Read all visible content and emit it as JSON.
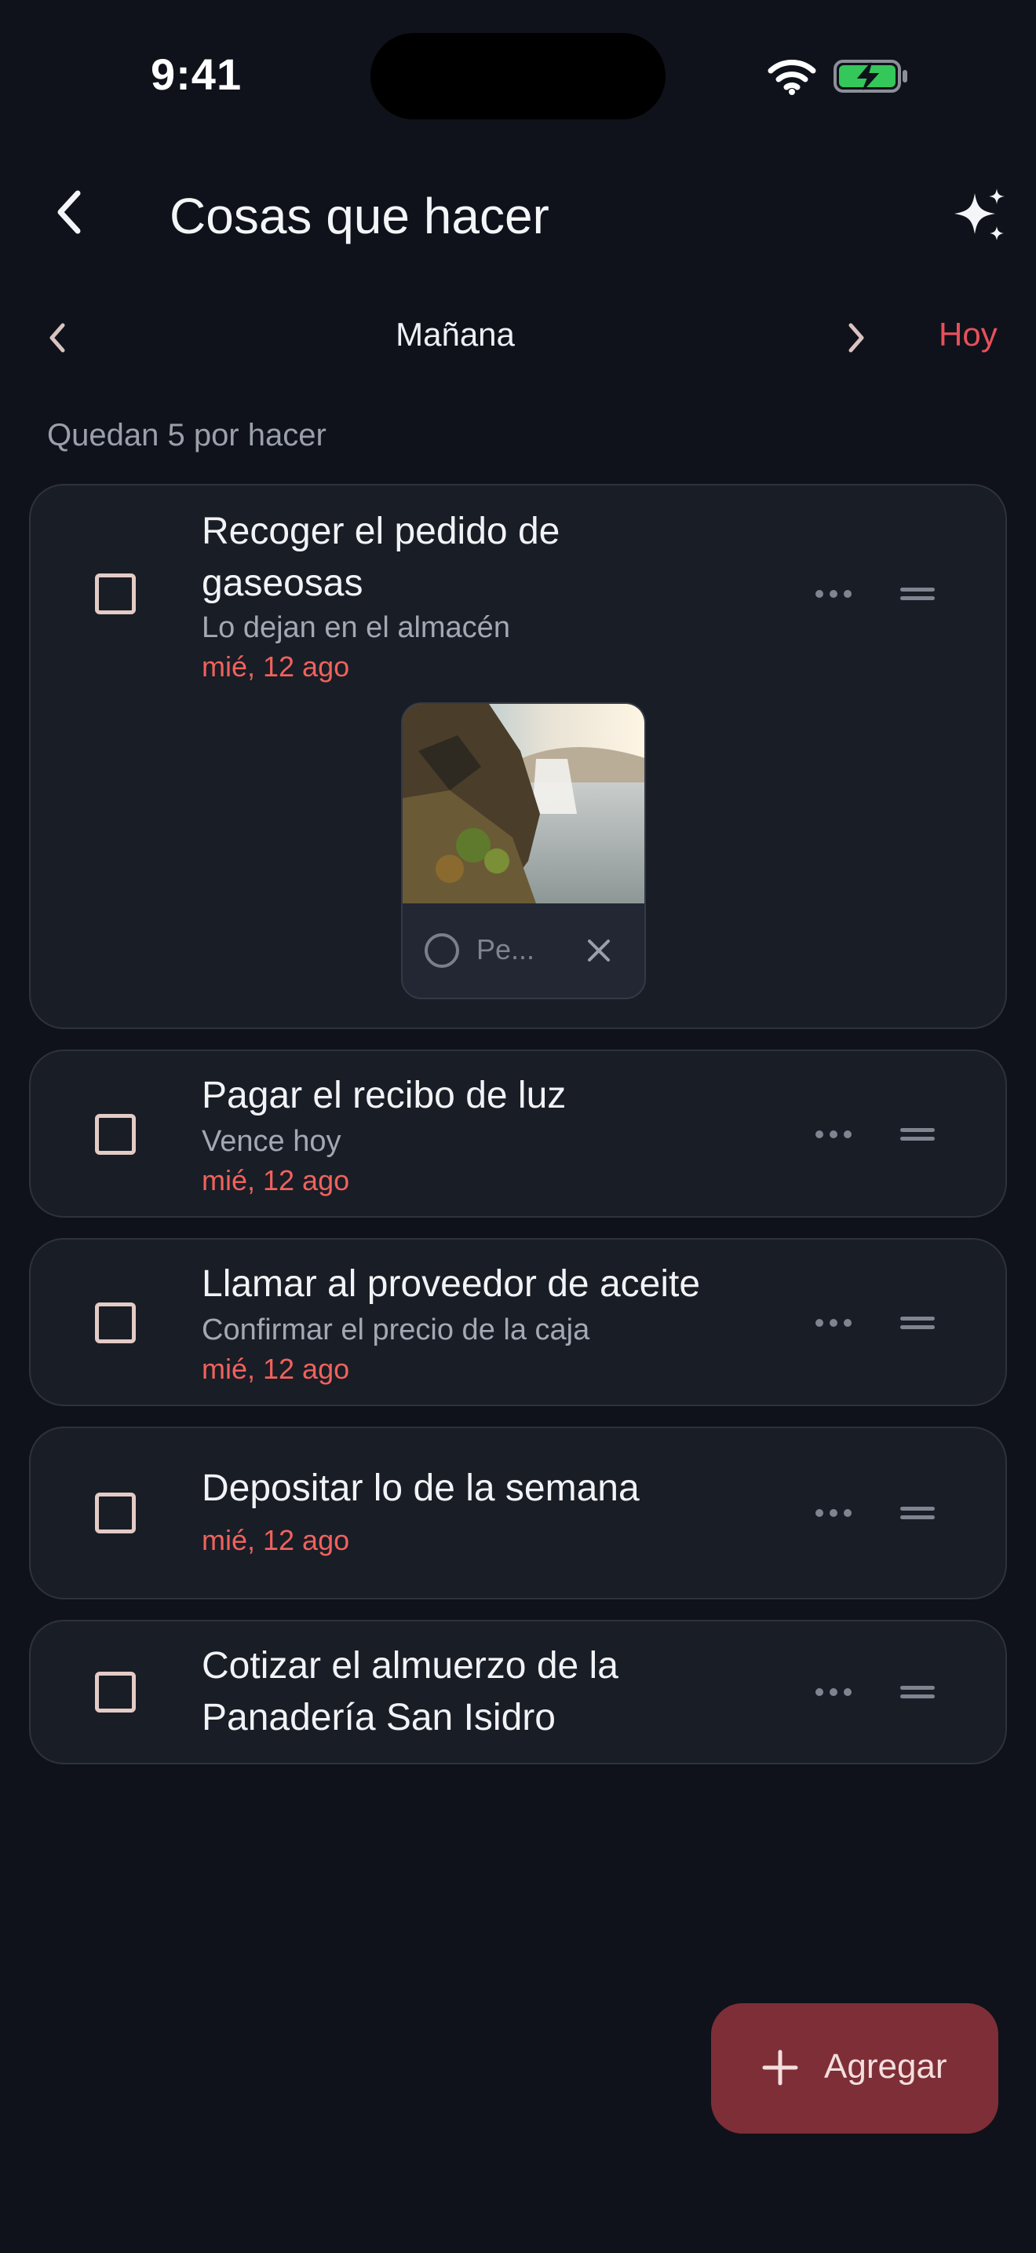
{
  "status_bar": {
    "time": "9:41"
  },
  "header": {
    "title": "Cosas que hacer"
  },
  "date_nav": {
    "label": "Mañana",
    "today": "Hoy"
  },
  "summary": {
    "remaining": "Quedan 5 por hacer"
  },
  "tasks": [
    {
      "title": "Recoger el pedido de gaseosas",
      "subtitle": "Lo dejan en el almacén",
      "date": "mié, 12 ago",
      "attachment": {
        "label": "Pe..."
      }
    },
    {
      "title": "Pagar el recibo de luz",
      "subtitle": "Vence hoy",
      "date": "mié, 12 ago"
    },
    {
      "title": "Llamar al proveedor de aceite",
      "subtitle": "Confirmar el precio de la caja",
      "date": "mié, 12 ago"
    },
    {
      "title": "Depositar lo de la semana",
      "date": "mié, 12 ago"
    },
    {
      "title": "Cotizar el almuerzo de la Panadería San Isidro"
    }
  ],
  "fab": {
    "label": "Agregar"
  },
  "colors": {
    "background": "#0f121a",
    "card": "#191d26",
    "accent": "#e8505b",
    "date": "#f0625c",
    "fab": "#7e2e36"
  }
}
